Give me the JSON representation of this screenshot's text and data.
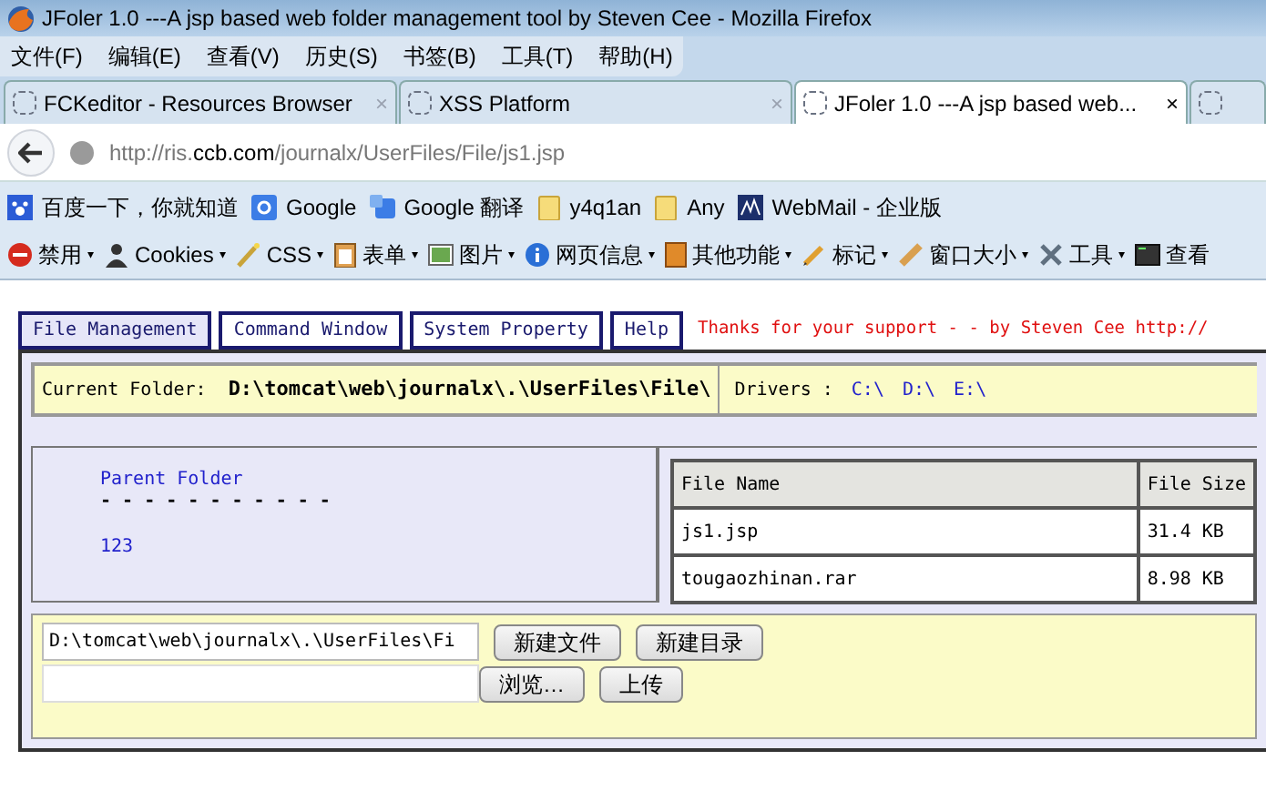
{
  "window": {
    "title": "JFoler 1.0 ---A jsp based web folder management tool by Steven Cee - Mozilla Firefox"
  },
  "menu": [
    "文件(F)",
    "编辑(E)",
    "查看(V)",
    "历史(S)",
    "书签(B)",
    "工具(T)",
    "帮助(H)"
  ],
  "browser_tabs": [
    {
      "label": "FCKeditor - Resources Browser",
      "selected": false
    },
    {
      "label": "XSS Platform",
      "selected": false
    },
    {
      "label": "JFoler 1.0 ---A jsp based web...",
      "selected": true
    }
  ],
  "tab_close": "×",
  "dropdown_glyph": "▾",
  "address": {
    "host_prefix": "http://ris.",
    "host": "ccb.com",
    "path": "/journalx/UserFiles/File/js1.jsp"
  },
  "bookmarks": [
    {
      "label": "百度一下，你就知道",
      "kind": "paw"
    },
    {
      "label": "Google",
      "kind": "g"
    },
    {
      "label": "Google 翻译",
      "kind": "translate"
    },
    {
      "label": "y4q1an",
      "kind": "folder"
    },
    {
      "label": "Any",
      "kind": "folder"
    },
    {
      "label": "WebMail - 企业版",
      "kind": "mail"
    }
  ],
  "toolbar": [
    {
      "label": "禁用",
      "kind": "ban"
    },
    {
      "label": "Cookies",
      "kind": "person"
    },
    {
      "label": "CSS",
      "kind": "wand"
    },
    {
      "label": "表单",
      "kind": "clipboard"
    },
    {
      "label": "图片",
      "kind": "image"
    },
    {
      "label": "网页信息",
      "kind": "info"
    },
    {
      "label": "其他功能",
      "kind": "book"
    },
    {
      "label": "标记",
      "kind": "pencil"
    },
    {
      "label": "窗口大小",
      "kind": "ruler"
    },
    {
      "label": "工具",
      "kind": "tools"
    },
    {
      "label": "查看",
      "kind": "screen"
    }
  ],
  "nav_tabs": [
    {
      "label": "File Management",
      "selected": true
    },
    {
      "label": "Command Window",
      "selected": false
    },
    {
      "label": "System Property",
      "selected": false
    },
    {
      "label": "Help",
      "selected": false
    }
  ],
  "credit": "Thanks for your support - - by Steven Cee http://",
  "current_folder": {
    "label": "Current Folder:",
    "path": "D:\\tomcat\\web\\journalx\\.\\UserFiles\\File\\"
  },
  "drivers": {
    "label": "Drivers :",
    "items": [
      "C:\\",
      "D:\\",
      "E:\\"
    ]
  },
  "folders": {
    "parent": "Parent Folder",
    "separator": "- - - - - - - - - - -",
    "items": [
      "123"
    ]
  },
  "table": {
    "columns": [
      "File Name",
      "File Size"
    ],
    "rows": [
      [
        "js1.jsp",
        "31.4 KB"
      ],
      [
        "tougaozhinan.rar",
        "8.98 KB"
      ]
    ]
  },
  "form": {
    "path_value": "D:\\tomcat\\web\\journalx\\.\\UserFiles\\Fi",
    "new_file": "新建文件",
    "new_dir": "新建目录",
    "browse": "浏览…",
    "upload": "上传"
  }
}
